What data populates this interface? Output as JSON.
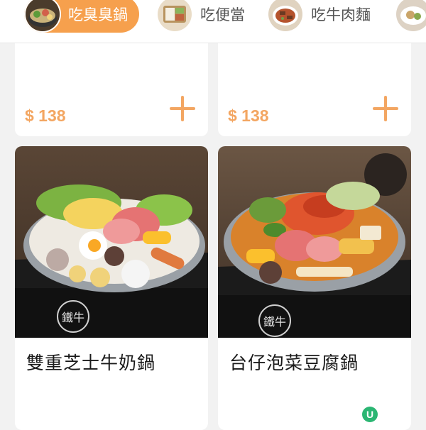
{
  "tabs": [
    {
      "label": "吃臭臭鍋",
      "active": true,
      "thumb_icon": "stinky-tofu-hotpot-thumbnail"
    },
    {
      "label": "吃便當",
      "active": false,
      "thumb_icon": "bento-thumbnail"
    },
    {
      "label": "吃牛肉麵",
      "active": false,
      "thumb_icon": "beef-noodle-thumbnail"
    },
    {
      "label": "",
      "active": false,
      "thumb_icon": "more-category-thumbnail"
    }
  ],
  "cards_top": [
    {
      "price": "$ 138"
    },
    {
      "price": "$ 138"
    }
  ],
  "cards_bottom": [
    {
      "name": "雙重芝士牛奶鍋",
      "brand": "鐵牛"
    },
    {
      "name": "台仔泡菜豆腐鍋",
      "brand": "鐵牛"
    }
  ],
  "watermark": {
    "letter": "U"
  },
  "colors": {
    "accent": "#f6a04d",
    "price": "#f3a662",
    "background": "#f2f2f2"
  }
}
